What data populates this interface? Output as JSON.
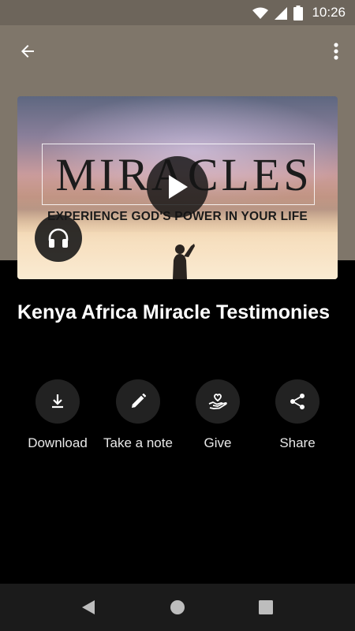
{
  "status_bar": {
    "time": "10:26"
  },
  "header": {
    "back_icon": "arrow-left-icon",
    "menu_icon": "more-vertical-icon"
  },
  "artwork": {
    "title": "MIRACLES",
    "subtitle": "EXPERIENCE GOD'S POWER IN YOUR LIFE"
  },
  "media": {
    "title": "Kenya Africa Miracle Testimonies"
  },
  "actions": [
    {
      "label": "Download",
      "icon": "download-icon"
    },
    {
      "label": "Take a note",
      "icon": "pencil-icon"
    },
    {
      "label": "Give",
      "icon": "hand-heart-icon"
    },
    {
      "label": "Share",
      "icon": "share-icon"
    }
  ],
  "colors": {
    "header_bg": "#7f766a",
    "page_bg": "#000000",
    "button_bg": "#222222"
  }
}
